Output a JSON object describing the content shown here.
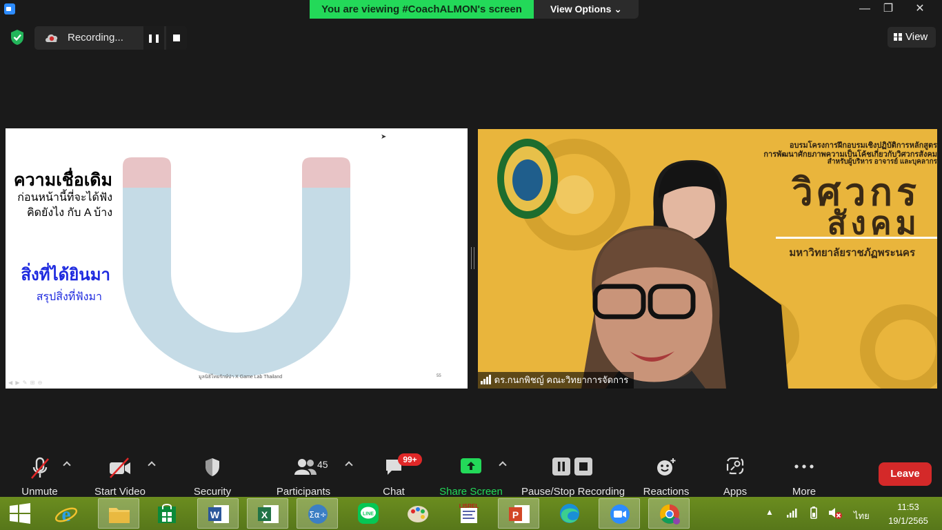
{
  "titlebar": {
    "banner_text": "You are viewing #CoachALMON's screen",
    "view_options_label": "View Options ⌄",
    "minimize": "—",
    "maximize": "❐",
    "close": "✕"
  },
  "status": {
    "recording_label": "Recording...",
    "view_label": "View"
  },
  "slide": {
    "heading1": "ความเชื่อเดิม",
    "line1": "ก่อนหน้านี้ที่จะได้ฟัง",
    "line2": "คิดยังไง กับ A บ้าง",
    "heading2": "สิ่งที่ได้ยินมา",
    "line3": "สรุปสิ่งที่ฟังมา",
    "footer": "มูลนิธิไทยรักษ์ป่า X Game Lab Thailand",
    "page_number": "55",
    "colors": {
      "magnet_tip": "#e8c4c6",
      "magnet_body": "#c5dbe6",
      "heading2": "#1e2adf"
    }
  },
  "video": {
    "participant_name": "ดร.กนกพิชญ์ คณะวิทยาการจัดการ",
    "banner_line1": "อบรมโครงการฝึกอบรมเชิงปฏิบัติการหลักสูตร",
    "banner_line2": "การพัฒนาศักยภาพความเป็นโค้ชเกี่ยวกับวิศวกรสังคม",
    "banner_line3": "สำหรับผู้บริหาร อาจารย์ และบุคลากร",
    "big1": "วิศวกร",
    "big2": "สังคม",
    "university": "มหาวิทยาลัยราชภัฏพระนคร"
  },
  "toolbar": {
    "unmute": "Unmute",
    "start_video": "Start Video",
    "security": "Security",
    "participants": "Participants",
    "participants_count": "45",
    "chat": "Chat",
    "chat_badge": "99+",
    "share_screen": "Share Screen",
    "pause_stop_recording": "Pause/Stop Recording",
    "reactions": "Reactions",
    "apps": "Apps",
    "more": "More",
    "leave": "Leave",
    "share_color": "#23d959"
  },
  "taskbar": {
    "language": "ไทย",
    "time": "11:53",
    "date": "19/1/2565",
    "lisrel_label": "LISREL"
  }
}
